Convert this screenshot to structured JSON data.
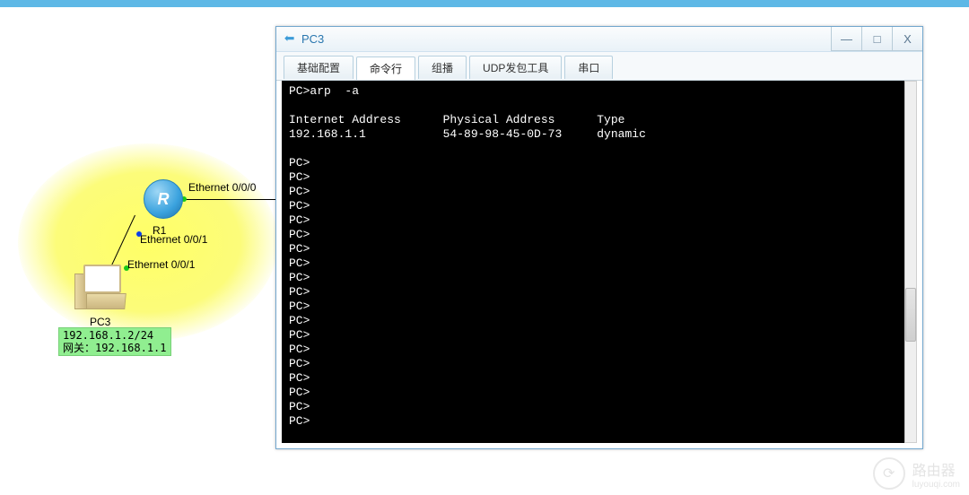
{
  "window": {
    "title": "PC3",
    "controls": {
      "min": "—",
      "max": "□",
      "close": "X"
    },
    "tabs": [
      {
        "label": "基础配置",
        "active": false
      },
      {
        "label": "命令行",
        "active": true
      },
      {
        "label": "组播",
        "active": false
      },
      {
        "label": "UDP发包工具",
        "active": false
      },
      {
        "label": "串口",
        "active": false
      }
    ]
  },
  "terminal": {
    "command": "PC>arp  -a",
    "header_col1": "Internet Address",
    "header_col2": "Physical Address",
    "header_col3": "Type",
    "row_ip": "192.168.1.1",
    "row_mac": "54-89-98-45-0D-73",
    "row_type": "dynamic",
    "prompt": "PC>",
    "prompt_count": 19
  },
  "topology": {
    "router_label": "R",
    "router_name": "R1",
    "eth0": "Ethernet 0/0/0",
    "eth1a": "Ethernet 0/0/1",
    "eth1b": "Ethernet 0/0/1",
    "pc_name": "PC3",
    "pc_ip": "192.168.1.2/24",
    "pc_gateway_label": "网关：",
    "pc_gateway": "192.168.1.1"
  },
  "watermark": {
    "brand": "路由器",
    "sub": "luyouqi.com"
  }
}
